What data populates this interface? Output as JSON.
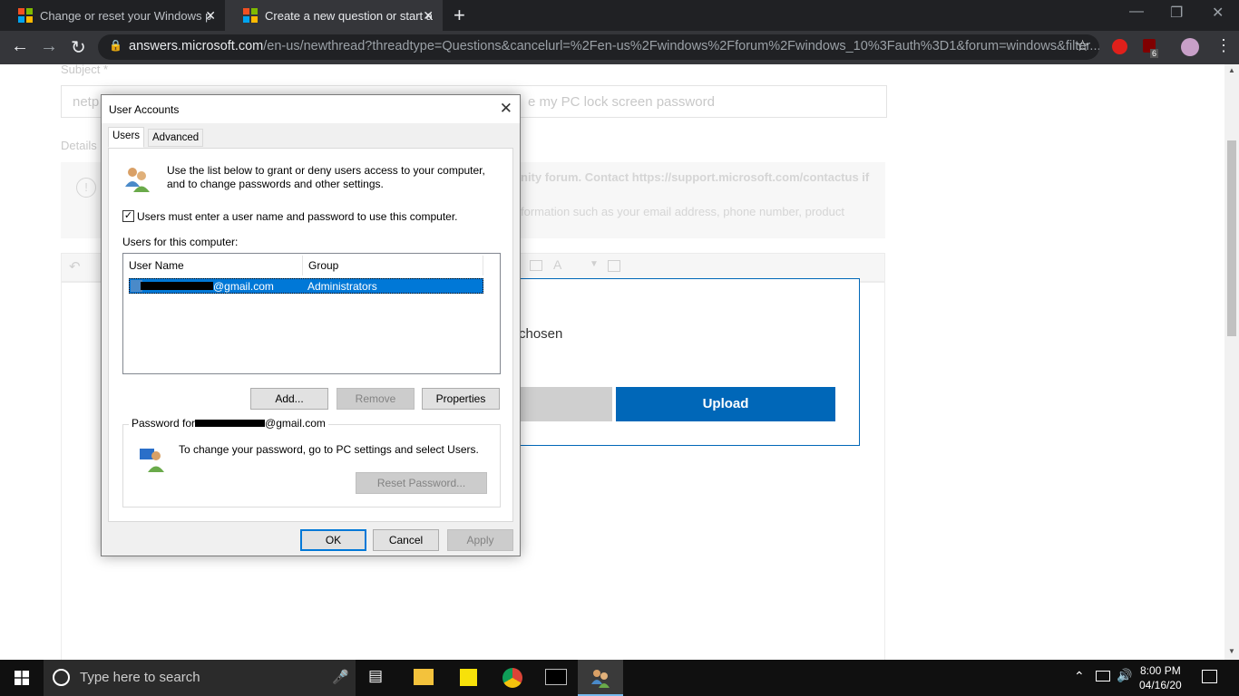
{
  "browser": {
    "tabs": [
      {
        "title": "Change or reset your Windows p",
        "close": "✕"
      },
      {
        "title": "Create a new question or start a",
        "close": "✕"
      }
    ],
    "new_tab": "+",
    "url_host": "answers.microsoft.com",
    "url_rest": "/en-us/newthread?threadtype=Questions&cancelurl=%2Fen-us%2Fwindows%2Fforum%2Fwindows_10%3Fauth%3D1&forum=windows&filter...",
    "ext_badge": "6"
  },
  "page": {
    "subject_label": "Subject *",
    "subject_value": "netp",
    "subject_value_end": "e my PC lock screen password",
    "details_label": "Details",
    "notice_line1": "nity forum. Contact https://support.microsoft.com/contactus if",
    "notice_line2": "formation such as your email address, phone number, product",
    "chosen_text": "chosen",
    "upload_label": "Upload"
  },
  "dialog": {
    "title": "User Accounts",
    "tabs": [
      "Users",
      "Advanced"
    ],
    "intro_line1": "Use the list below to grant or deny users access to your computer,",
    "intro_line2": "and to change passwords and other settings.",
    "checkbox_label": "Users must enter a user name and password to use this computer.",
    "checkbox_checked": true,
    "users_label": "Users for this computer:",
    "columns": [
      "User Name",
      "Group"
    ],
    "rows": [
      {
        "user": "@gmail.com",
        "group": "Administrators"
      }
    ],
    "buttons": {
      "add": "Add...",
      "remove": "Remove",
      "properties": "Properties"
    },
    "password_group_title_prefix": "Password for",
    "password_group_title_suffix": "@gmail.com",
    "password_text": "To change your password, go to PC settings and select Users.",
    "reset_password": "Reset Password...",
    "ok": "OK",
    "cancel": "Cancel",
    "apply": "Apply"
  },
  "taskbar": {
    "search_placeholder": "Type here to search",
    "time": "8:00 PM",
    "date": "04/16/20"
  },
  "colors": {
    "accent": "#0078d7",
    "upload_blue": "#0067b8"
  }
}
